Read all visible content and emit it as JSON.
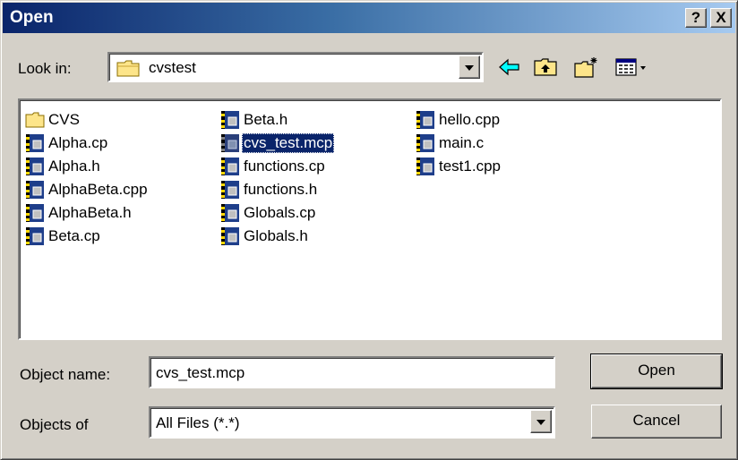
{
  "window": {
    "title": "Open",
    "help_label": "?",
    "close_label": "X"
  },
  "lookin": {
    "label": "Look in:",
    "value": "cvstest",
    "icon": "folder-icon"
  },
  "toolbar": {
    "icons": [
      "back-icon",
      "up-one-level-icon",
      "new-folder-icon",
      "view-menu-icon"
    ]
  },
  "files": [
    {
      "name": "CVS",
      "type": "folder"
    },
    {
      "name": "Alpha.cp",
      "type": "file"
    },
    {
      "name": "Alpha.h",
      "type": "file"
    },
    {
      "name": "AlphaBeta.cpp",
      "type": "file"
    },
    {
      "name": "AlphaBeta.h",
      "type": "file"
    },
    {
      "name": "Beta.cp",
      "type": "file"
    },
    {
      "name": "Beta.h",
      "type": "file"
    },
    {
      "name": "cvs_test.mcp",
      "type": "project",
      "selected": true
    },
    {
      "name": "functions.cp",
      "type": "file"
    },
    {
      "name": "functions.h",
      "type": "file"
    },
    {
      "name": "Globals.cp",
      "type": "file"
    },
    {
      "name": "Globals.h",
      "type": "file"
    },
    {
      "name": "hello.cpp",
      "type": "file"
    },
    {
      "name": "main.c",
      "type": "file"
    },
    {
      "name": "test1.cpp",
      "type": "file"
    }
  ],
  "object_name": {
    "label": "Object name:",
    "value": "cvs_test.mcp"
  },
  "objects_of": {
    "label": "Objects of",
    "value": "All Files (*.*)"
  },
  "buttons": {
    "open": "Open",
    "cancel": "Cancel"
  },
  "colors": {
    "face": "#d4d0c8",
    "title_start": "#0a246a",
    "title_end": "#a6caf0",
    "selection": "#0a246a"
  }
}
